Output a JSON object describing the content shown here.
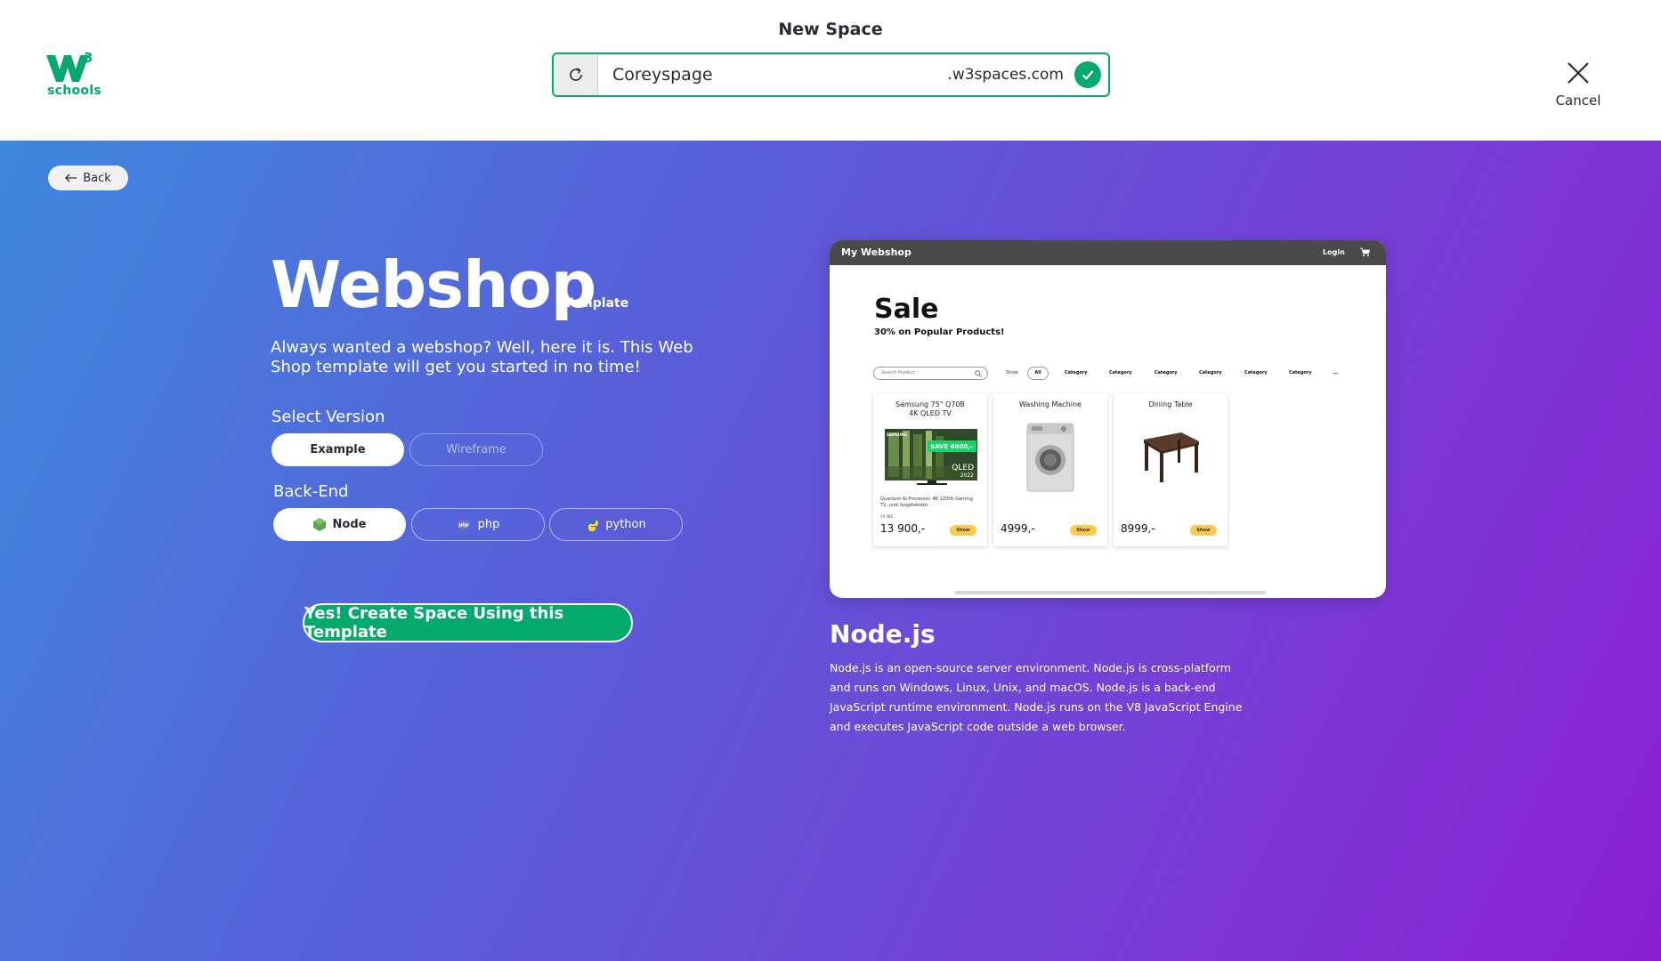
{
  "header": {
    "logo_superscript": "3",
    "logo_text": "schools",
    "title": "New Space",
    "url_value": "Coreyspage",
    "url_suffix": ".w3spaces.com",
    "cancel_label": "Cancel"
  },
  "back_label": "Back",
  "template": {
    "name": "Webshop",
    "suffix": "Template",
    "description": "Always wanted a webshop? Well, here it is. This Web Shop template will get you started in no time!"
  },
  "version": {
    "label": "Select Version",
    "options": [
      "Example",
      "Wireframe"
    ],
    "selected": "Example"
  },
  "backend": {
    "label": "Back-End",
    "options": [
      "Node",
      "php",
      "python"
    ],
    "selected": "Node"
  },
  "create_button": "Yes! Create Space Using this Template",
  "preview": {
    "brand": "My Webshop",
    "login": "Login",
    "heading": "Sale",
    "subheading": "30% on Popular Products!",
    "search_placeholder": "Search Product",
    "show_label": "Show:",
    "filter_all": "All",
    "categories": [
      "Category",
      "Category",
      "Category",
      "Category",
      "Category",
      "Category",
      "..."
    ],
    "products": [
      {
        "title": "Samsung 75\" Q70B 4K QLED TV",
        "note": "Quantum AI Processor, 4K 120Hz Gaming TV, unik fargeteknikk",
        "was": "19 385,-",
        "price": "13 900,-",
        "button": "Show",
        "badge": "SAVE 6000,-",
        "tv_brand": "SAMSUNG",
        "tv_label": "QLED",
        "tv_year": "2022"
      },
      {
        "title": "Washing Machine",
        "price": "4999,-",
        "button": "Show"
      },
      {
        "title": "Dining Table",
        "price": "8999,-",
        "button": "Show"
      }
    ]
  },
  "backend_info": {
    "title": "Node.js",
    "description": "Node.js is an open-source server environment. Node.js is cross-platform and runs on Windows, Linux, Unix, and macOS. Node.js is a back-end JavaScript runtime environment. Node.js runs on the V8 JavaScript Engine and executes JavaScript code outside a web browser."
  },
  "colors": {
    "brand_green": "#04aa6d",
    "gradient_start": "#3f88de",
    "gradient_end": "#8a1fd0",
    "button_yellow": "#ffc94d"
  },
  "icons": {
    "logo": "w3schools-logo",
    "refresh": "refresh-icon",
    "check": "check-circle-icon",
    "cancel": "close-icon",
    "back": "arrow-left-icon",
    "node": "nodejs-icon",
    "php": "php-icon",
    "python": "python-icon",
    "cart": "cart-icon",
    "search": "search-icon"
  }
}
